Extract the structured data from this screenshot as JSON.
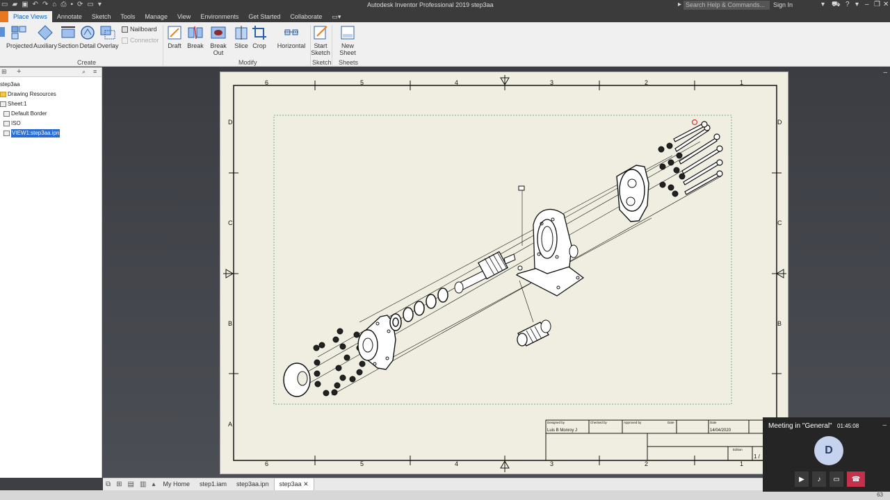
{
  "window": {
    "title": "Autodesk Inventor Professional 2019   step3aa",
    "search_placeholder": "Search Help & Commands...",
    "signin": "Sign In"
  },
  "menu": {
    "tabs": [
      "Place Views",
      "Annotate",
      "Sketch",
      "Tools",
      "Manage",
      "View",
      "Environments",
      "Get Started",
      "Collaborate"
    ],
    "active": "Place Views"
  },
  "ribbon": {
    "create": {
      "label": "Create",
      "buttons": [
        "Projected",
        "Auxiliary",
        "Section",
        "Detail",
        "Overlay"
      ],
      "nailboard": "Nailboard",
      "connector": "Connector"
    },
    "modify": {
      "label": "Modify",
      "buttons": [
        "Draft",
        "Break",
        "Break Out",
        "Slice",
        "Crop"
      ],
      "horizontal": "Horizontal"
    },
    "sketch": {
      "label": "Sketch",
      "start_line1": "Start",
      "start_line2": "Sketch"
    },
    "sheets": {
      "label": "Sheets",
      "new_sheet": "New Sheet"
    }
  },
  "browser": {
    "root": "step3aa",
    "items": [
      "Drawing Resources",
      "Sheet:1",
      "Default Border",
      "ISO",
      "VIEW1:step3aa.ipn"
    ],
    "selected": "VIEW1:step3aa.ipn"
  },
  "drawing": {
    "zone_numbers": [
      "6",
      "5",
      "4",
      "3",
      "2",
      "1"
    ],
    "zone_letters": [
      "D",
      "C",
      "B",
      "A"
    ],
    "title_block": {
      "designed_by_label": "Designed by",
      "checked_by_label": "Checked by",
      "approved_by_label": "Approved by",
      "date_label": "Date",
      "date_label2": "Date",
      "designer": "Luis B Monroy J",
      "date": "14/04/2020",
      "edition_label": "Edition",
      "sheet": "1 /"
    }
  },
  "doc_tabs": {
    "items": [
      "My Home",
      "step1.iam",
      "step3aa.ipn",
      "step3aa"
    ],
    "active": "step3aa"
  },
  "meeting": {
    "title": "Meeting in \"General\"",
    "time": "01:45:08",
    "avatar": "D",
    "badge": "63"
  },
  "colors": {
    "sheet": "#efeee0",
    "accent": "#2a6ccf",
    "hangup": "#c4314b"
  }
}
